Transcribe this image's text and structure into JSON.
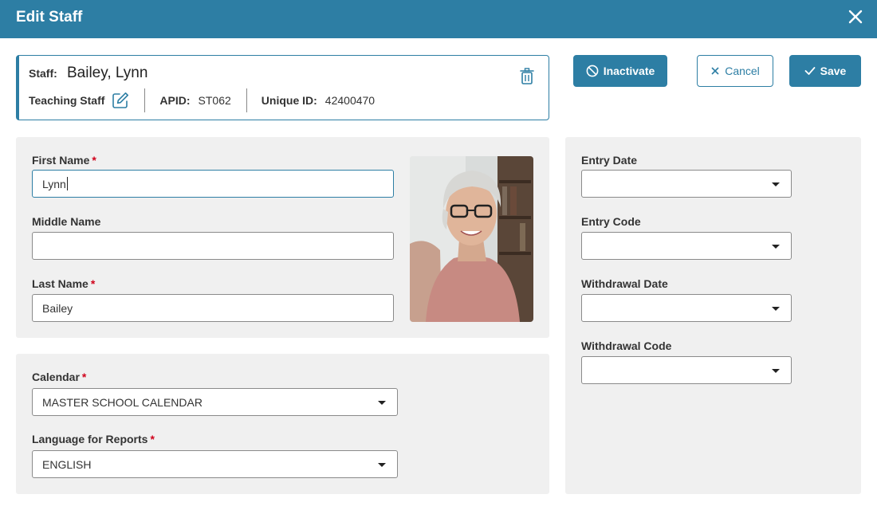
{
  "dialog": {
    "title": "Edit Staff"
  },
  "staff": {
    "label": "Staff:",
    "name": "Bailey, Lynn",
    "type": "Teaching Staff",
    "apid_label": "APID:",
    "apid": "ST062",
    "unique_label": "Unique ID:",
    "unique_id": "42400470"
  },
  "actions": {
    "inactivate": "Inactivate",
    "cancel": "Cancel",
    "save": "Save"
  },
  "name_form": {
    "first_label": "First Name",
    "first_value": "Lynn",
    "middle_label": "Middle Name",
    "middle_value": "",
    "last_label": "Last Name",
    "last_value": "Bailey",
    "required_mark": "*"
  },
  "calendar_form": {
    "calendar_label": "Calendar",
    "calendar_value": "MASTER SCHOOL CALENDAR",
    "language_label": "Language for Reports",
    "language_value": "ENGLISH"
  },
  "entry_form": {
    "entry_date_label": "Entry Date",
    "entry_code_label": "Entry Code",
    "withdrawal_date_label": "Withdrawal Date",
    "withdrawal_code_label": "Withdrawal Code"
  },
  "colors": {
    "primary": "#2d7ea4",
    "panel": "#f0f0f0",
    "required": "#d0021b"
  }
}
